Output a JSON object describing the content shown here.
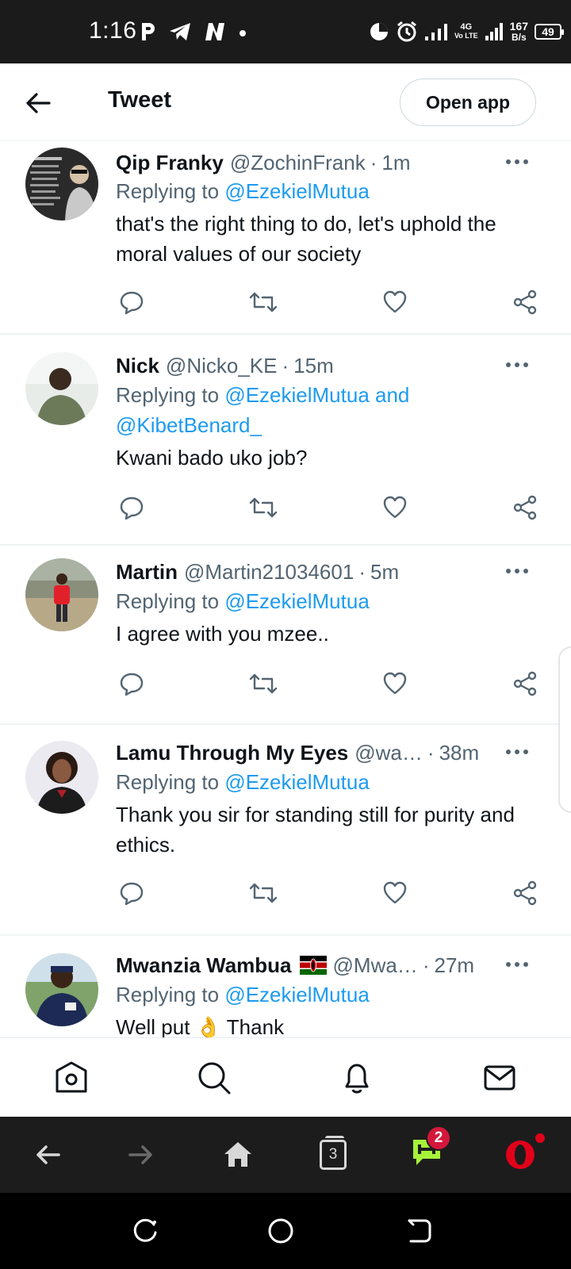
{
  "status_bar": {
    "time": "1:16",
    "left_icons": [
      "p-icon",
      "telegram-icon",
      "n-icon",
      "dot-icon"
    ],
    "network_label": "Vo LTE",
    "network_gen": "4G",
    "speed_value": "167",
    "speed_unit": "B/s",
    "battery": "49"
  },
  "header": {
    "title": "Tweet",
    "open_app_label": "Open app"
  },
  "tweets": [
    {
      "author": "Qip Franky",
      "handle": "@ZochinFrank",
      "separator": "·",
      "time": "1m",
      "replying_prefix": "Replying to ",
      "replying_to": "@EzekielMutua",
      "replying_to_2": "",
      "text": "that's the right thing to do, let's uphold the moral values of our society"
    },
    {
      "author": "Nick",
      "handle": "@Nicko_KE",
      "separator": "·",
      "time": "15m",
      "replying_prefix": "Replying to ",
      "replying_to": "@EzekielMutua and",
      "replying_to_2": "@KibetBenard_",
      "text": "Kwani bado uko job?"
    },
    {
      "author": "Martin",
      "handle": "@Martin21034601",
      "separator": "·",
      "time": "5m",
      "replying_prefix": "Replying to ",
      "replying_to": "@EzekielMutua",
      "replying_to_2": "",
      "text": "I agree with you mzee.."
    },
    {
      "author": "Lamu Through My Eyes",
      "handle": "@wa…",
      "separator": "·",
      "time": "38m",
      "replying_prefix": "Replying to ",
      "replying_to": "@EzekielMutua",
      "replying_to_2": "",
      "text": "Thank you sir for standing still for purity and ethics."
    },
    {
      "author": "Mwanzia Wambua",
      "handle": "@Mwa…",
      "separator": "·",
      "time": "27m",
      "replying_prefix": "Replying to ",
      "replying_to": "@EzekielMutua",
      "replying_to_2": "",
      "text": "Well put 👌 Thank"
    }
  ],
  "browser_bar": {
    "tab_count": "3",
    "chat_badge": "2"
  },
  "colors": {
    "link": "#1d9bf0",
    "secondary_text": "#536471",
    "status_bar": "#1b1b1b",
    "browser_bar": "#1c1c1c",
    "badge": "#d3173b",
    "opera_red": "#e1001a"
  }
}
